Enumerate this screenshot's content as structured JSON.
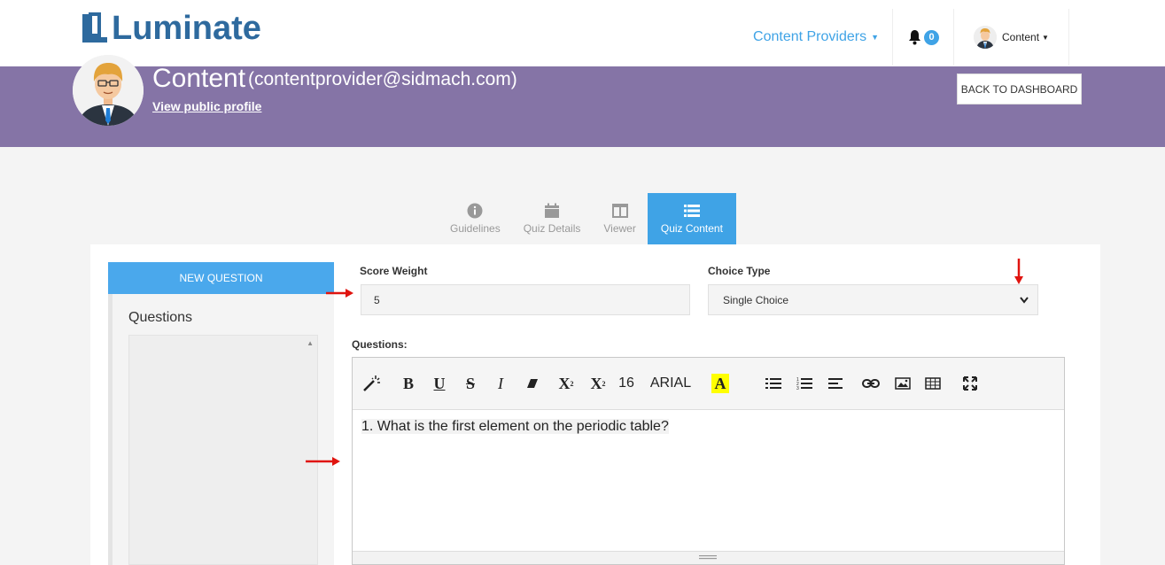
{
  "brand": {
    "name": "Luminate"
  },
  "nav": {
    "providers_label": "Content Providers",
    "notification_count": "0",
    "user_label": "Content"
  },
  "profile": {
    "name": "Content",
    "email": "(contentprovider@sidmach.com)",
    "public_profile_link": "View public profile",
    "back_button": "BACK TO DASHBOARD"
  },
  "tabs": [
    {
      "label": "Guidelines",
      "icon": "info-icon",
      "active": false
    },
    {
      "label": "Quiz Details",
      "icon": "calendar-icon",
      "active": false
    },
    {
      "label": "Viewer",
      "icon": "columns-icon",
      "active": false
    },
    {
      "label": "Quiz Content",
      "icon": "list-icon",
      "active": true
    }
  ],
  "sidebar": {
    "new_question_button": "NEW QUESTION",
    "questions_title": "Questions"
  },
  "form": {
    "score_weight_label": "Score Weight",
    "score_weight_value": "5",
    "choice_type_label": "Choice Type",
    "choice_type_value": "Single Choice",
    "questions_label": "Questions:"
  },
  "editor": {
    "font_size": "16",
    "font_name": "ARIAL",
    "color_button_label": "A",
    "content": "1. What is the first element on the periodic table?"
  },
  "colors": {
    "accent": "#3fa3e6",
    "header_band": "#8574a6",
    "logo": "#2e6a9e",
    "annotation_arrow": "#e0140f"
  }
}
